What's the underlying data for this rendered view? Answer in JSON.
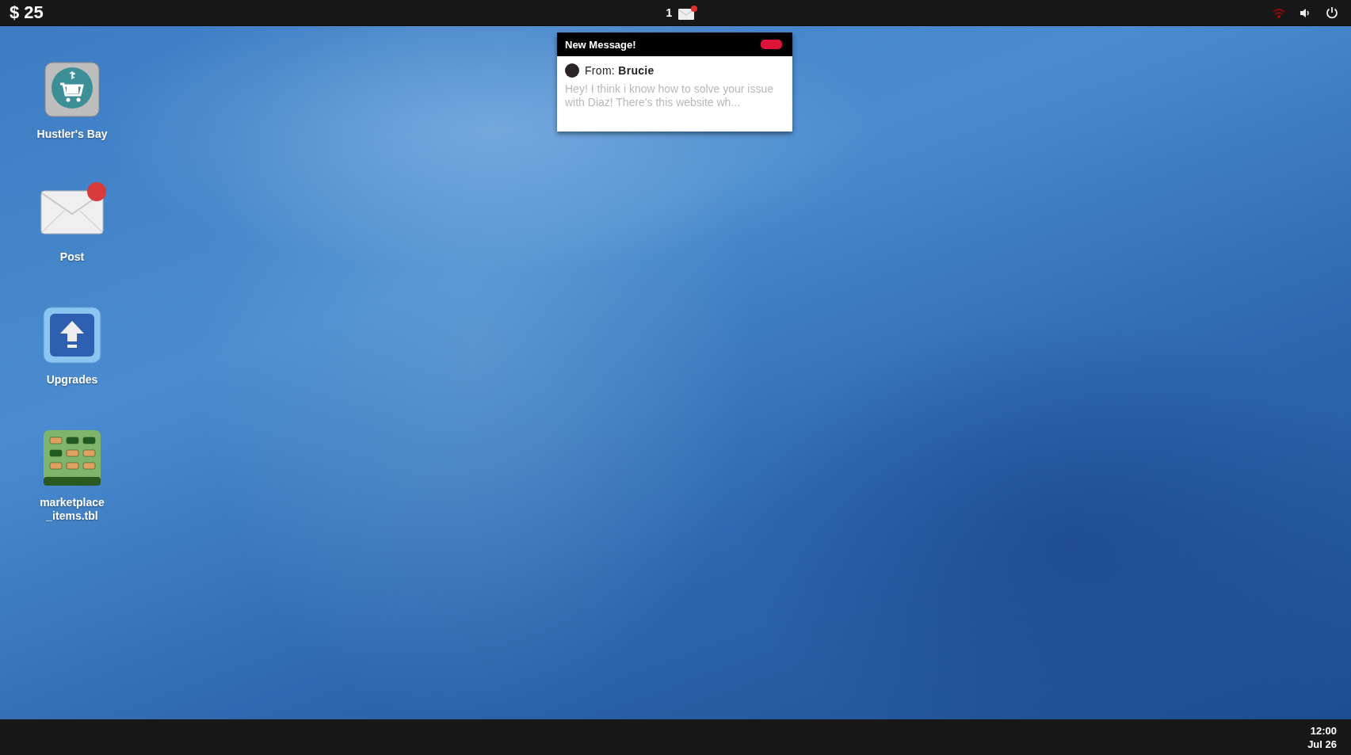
{
  "top_bar": {
    "money": "$ 25",
    "mail_count": "1",
    "mail_unread": true,
    "wifi_connected": false
  },
  "notification": {
    "title": "New Message!",
    "from_label": "From:",
    "sender": "Brucie",
    "preview": "Hey! I think i know how to solve your issue with Diaz! There's this website wh..."
  },
  "desktop_icons": [
    {
      "kind": "shop",
      "label": "Hustler's Bay",
      "badge": false
    },
    {
      "kind": "mail",
      "label": "Post",
      "badge": true
    },
    {
      "kind": "upload",
      "label": "Upgrades",
      "badge": false
    },
    {
      "kind": "table",
      "label": "marketplace\n_items.tbl",
      "badge": false
    }
  ],
  "taskbar": {
    "time": "12:00",
    "date": "Jul 26"
  }
}
